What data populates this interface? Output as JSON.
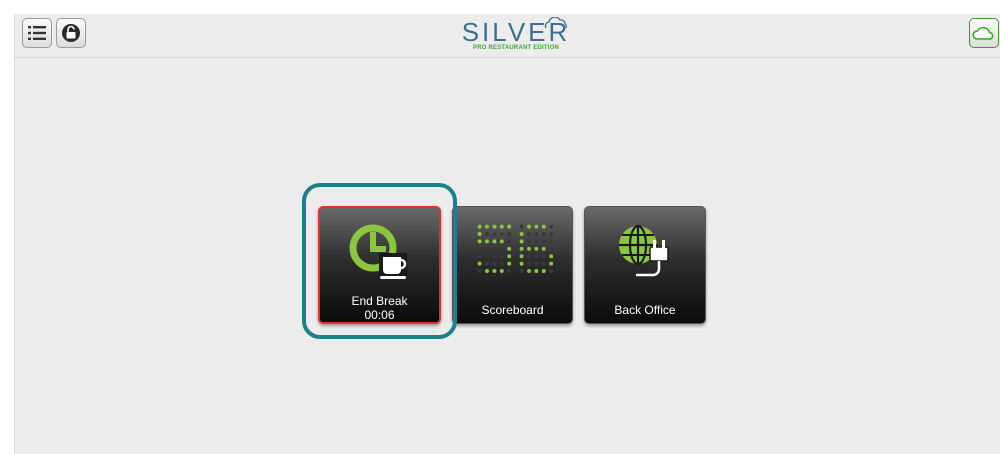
{
  "topbar": {
    "menu_icon": "list-menu-icon",
    "lock_icon": "unlock-icon",
    "cloud_icon": "cloud-icon",
    "logo": {
      "word": "SILVER",
      "subtitle": "PRO RESTAURANT EDITION"
    }
  },
  "tiles": {
    "end_break": {
      "label": "End Break",
      "timer": "00:06",
      "icon": "clock-coffee-icon"
    },
    "scoreboard": {
      "label": "Scoreboard",
      "icon": "scoreboard-digits-icon",
      "digits": "56"
    },
    "back_office": {
      "label": "Back Office",
      "icon": "globe-plug-icon"
    }
  },
  "colors": {
    "accent_green": "#8cc63f",
    "highlight_teal": "#1b7f8c",
    "alert_red": "#e03030",
    "logo_blue": "#3a6f8f"
  }
}
